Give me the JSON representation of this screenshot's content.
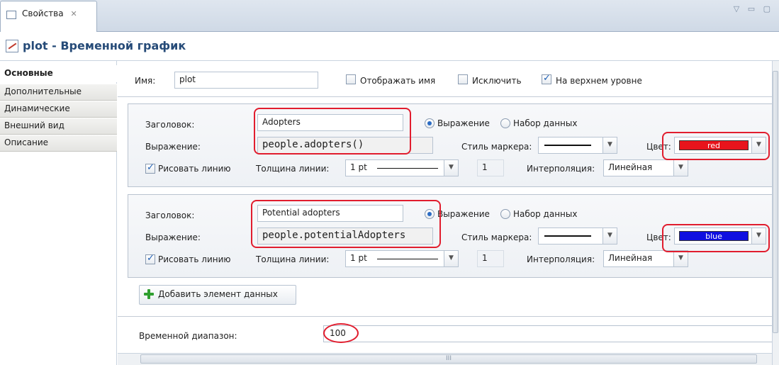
{
  "tab": {
    "label": "Свойства",
    "close": "✕",
    "icon": "properties-icon"
  },
  "window_controls": "▽ ▭ ▢",
  "header": {
    "title": "plot - Временной график",
    "icon": "time-plot-icon"
  },
  "nav": {
    "items": [
      "Основные",
      "Дополнительные",
      "Динамические",
      "Внешний вид",
      "Описание"
    ]
  },
  "general": {
    "name_label": "Имя:",
    "name_value": "plot",
    "show_name_label": "Отображать имя",
    "exclude_label": "Исключить",
    "top_level_label": "На верхнем уровне"
  },
  "datasets": [
    {
      "title_label": "Заголовок:",
      "title_value": "Adopters",
      "radio_expression": "Выражение",
      "radio_dataset": "Набор данных",
      "expr_label": "Выражение:",
      "expr_value": "people.adopters()",
      "marker_label": "Стиль маркера:",
      "color_label": "Цвет:",
      "color_value": "red",
      "color_hex": "#e8141c",
      "draw_line_label": "Рисовать линию",
      "thickness_label": "Толщина линии:",
      "thickness_value": "1 pt",
      "thickness_number": "1",
      "interp_label": "Интерполяция:",
      "interp_value": "Линейная"
    },
    {
      "title_label": "Заголовок:",
      "title_value": "Potential adopters",
      "radio_expression": "Выражение",
      "radio_dataset": "Набор данных",
      "expr_label": "Выражение:",
      "expr_value": "people.potentialAdopters",
      "marker_label": "Стиль маркера:",
      "color_label": "Цвет:",
      "color_value": "blue",
      "color_hex": "#1010e0",
      "draw_line_label": "Рисовать линию",
      "thickness_label": "Толщина линии:",
      "thickness_value": "1 pt",
      "thickness_number": "1",
      "interp_label": "Интерполяция:",
      "interp_value": "Линейная"
    }
  ],
  "add_button": "Добавить элемент данных",
  "time_range_label": "Временной диапазон:",
  "time_range_value": "100",
  "scroll_grip": "III"
}
